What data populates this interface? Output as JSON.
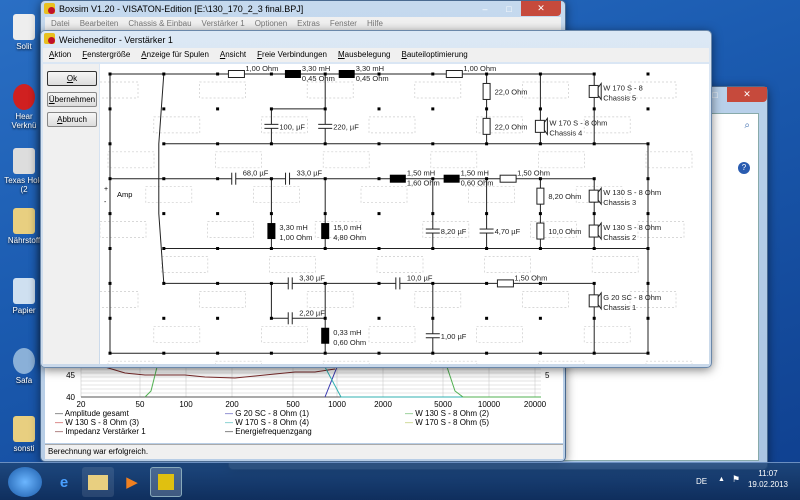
{
  "desktop": {
    "icons": [
      {
        "label": "Solit"
      },
      {
        "label": "Hear Verknü"
      },
      {
        "label": "Texas Hold (2"
      },
      {
        "label": "Nährstoff"
      },
      {
        "label": "Papier"
      },
      {
        "label": "Safa"
      },
      {
        "label": "sonsti"
      }
    ]
  },
  "main_window": {
    "title": "Boxsim V1.20 - VISATON-Edition [E:\\130_170_2_3 final.BPJ]",
    "menu": [
      "Datei",
      "Bearbeiten",
      "Chassis & Einbau",
      "Verstärker 1",
      "Optionen",
      "Extras",
      "Fenster",
      "Hilfe"
    ],
    "chart": {
      "y_ticks": [
        "45",
        "40"
      ],
      "y2_ticks": [
        "5"
      ],
      "x_ticks": [
        "20",
        "50",
        "100",
        "200",
        "500",
        "1000",
        "2000",
        "5000",
        "10000",
        "20000"
      ],
      "legend": [
        {
          "label": "Amplitude gesamt",
          "color": "#333333"
        },
        {
          "label": "G 20 SC - 8 Ohm (1)",
          "color": "#3a3ab0"
        },
        {
          "label": "W 130 S - 8 Ohm (2)",
          "color": "#50b050"
        },
        {
          "label": "W 130 S - 8 Ohm (3)",
          "color": "#c03030"
        },
        {
          "label": "W 170 S - 8 Ohm (4)",
          "color": "#30b0b0"
        },
        {
          "label": "W 170 S - 8 Ohm (5)",
          "color": "#b0c050"
        },
        {
          "label": "Impedanz Verstärker 1",
          "color": "#702020"
        },
        {
          "label": "Energiefrequenzgang",
          "color": "#202020"
        }
      ]
    },
    "status": "Berechnung war erfolgreich."
  },
  "dialog": {
    "title": "Weicheneditor - Verstärker 1",
    "menu": [
      "Aktion",
      "Fenstergröße",
      "Anzeige für Spulen",
      "Ansicht",
      "Freie Verbindungen",
      "Mausbelegung",
      "Bauteiloptimierung"
    ],
    "buttons": {
      "ok": "Ok",
      "apply": "Übernehmen",
      "cancel": "Abbruch"
    },
    "amp_label": "Amp",
    "plus": "+",
    "minus": "-",
    "components": [
      {
        "type": "resistor",
        "l1": "1,00 Ohm"
      },
      {
        "type": "coil",
        "l1": "3,30 mH",
        "l2": "0,45 Ohm"
      },
      {
        "type": "coil",
        "l1": "3,30 mH",
        "l2": "0,45 Ohm"
      },
      {
        "type": "resistor",
        "l1": "1,00 Ohm"
      },
      {
        "type": "capacitor",
        "l1": "100, µF"
      },
      {
        "type": "capacitor",
        "l1": "220, µF"
      },
      {
        "type": "resistor",
        "l1": "22,0 Ohm"
      },
      {
        "type": "resistor",
        "l1": "22,0 Ohm"
      },
      {
        "type": "speaker",
        "l1": "W 170 S - 8 Ohm",
        "l2": "Chassis 4"
      },
      {
        "type": "speaker",
        "l1": "W 170 S - 8",
        "l2": "Chassis 5"
      },
      {
        "type": "capacitor",
        "l1": "68,0 µF"
      },
      {
        "type": "capacitor",
        "l1": "33,0 µF"
      },
      {
        "type": "coil",
        "l1": "1,50 mH",
        "l2": "1,60 Ohm"
      },
      {
        "type": "coil",
        "l1": "1,50 mH",
        "l2": "0,60 Ohm"
      },
      {
        "type": "resistor",
        "l1": "1,50 Ohm"
      },
      {
        "type": "coil",
        "l1": "3,30 mH",
        "l2": "1,00 Ohm"
      },
      {
        "type": "coil",
        "l1": "15,0 mH",
        "l2": "4,80 Ohm"
      },
      {
        "type": "capacitor",
        "l1": "8,20 µF"
      },
      {
        "type": "capacitor",
        "l1": "4,70 µF"
      },
      {
        "type": "resistor",
        "l1": "8,20 Ohm"
      },
      {
        "type": "resistor",
        "l1": "10,0 Ohm"
      },
      {
        "type": "speaker",
        "l1": "W 130 S - 8 Ohm",
        "l2": "Chassis 3"
      },
      {
        "type": "speaker",
        "l1": "W 130 S - 8 Ohm",
        "l2": "Chassis 2"
      },
      {
        "type": "capacitor",
        "l1": "3,30 µF"
      },
      {
        "type": "capacitor",
        "l1": "10,0 µF"
      },
      {
        "type": "resistor",
        "l1": "1,50 Ohm"
      },
      {
        "type": "capacitor",
        "l1": "2,20 µF"
      },
      {
        "type": "coil",
        "l1": "0,33 mH",
        "l2": "0,60 Ohm"
      },
      {
        "type": "capacitor",
        "l1": "1,00 µF"
      },
      {
        "type": "speaker",
        "l1": "G 20 SC - 8 Ohm",
        "l2": "Chassis 1"
      }
    ]
  },
  "taskbar": {
    "lang": "DE",
    "time": "11:07",
    "date": "19.02.2013"
  }
}
